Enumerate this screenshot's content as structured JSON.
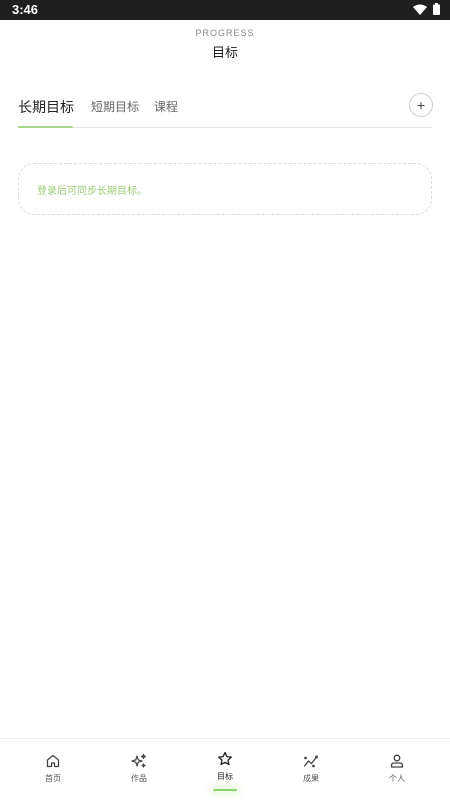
{
  "status_bar": {
    "time": "3:46"
  },
  "header": {
    "eyebrow": "PROGRESS",
    "title": "目标"
  },
  "tabs": [
    {
      "label": "长期目标",
      "active": true
    },
    {
      "label": "短期目标",
      "active": false
    },
    {
      "label": "课程",
      "active": false
    }
  ],
  "add_button": {
    "label": "+"
  },
  "empty_state": {
    "text": "登录后可同步长期目标。"
  },
  "bottom_nav": [
    {
      "label": "首页",
      "icon": "home-icon",
      "active": false
    },
    {
      "label": "作品",
      "icon": "sparkle-icon",
      "active": false
    },
    {
      "label": "目标",
      "icon": "star-icon",
      "active": true
    },
    {
      "label": "成果",
      "icon": "trend-icon",
      "active": false
    },
    {
      "label": "个人",
      "icon": "person-icon",
      "active": false
    }
  ],
  "colors": {
    "accent": "#a8d98a",
    "empty_text": "#9ccc78",
    "status_bar": "#1f1f1f"
  }
}
